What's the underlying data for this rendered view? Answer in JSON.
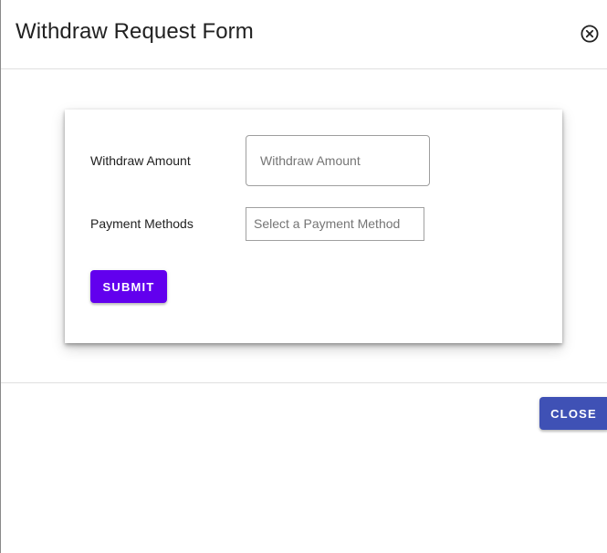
{
  "dialog": {
    "title": "Withdraw Request Form",
    "close_icon": "close-circle-icon"
  },
  "form": {
    "amount_label": "Withdraw Amount",
    "amount_placeholder": "Withdraw Amount",
    "amount_value": "",
    "methods_label": "Payment Methods",
    "methods_placeholder": "Select a Payment Method",
    "submit_label": "SUBMIT"
  },
  "footer": {
    "close_label": "CLOSE"
  },
  "colors": {
    "submit": "#6200ee",
    "close": "#3f51b5"
  }
}
